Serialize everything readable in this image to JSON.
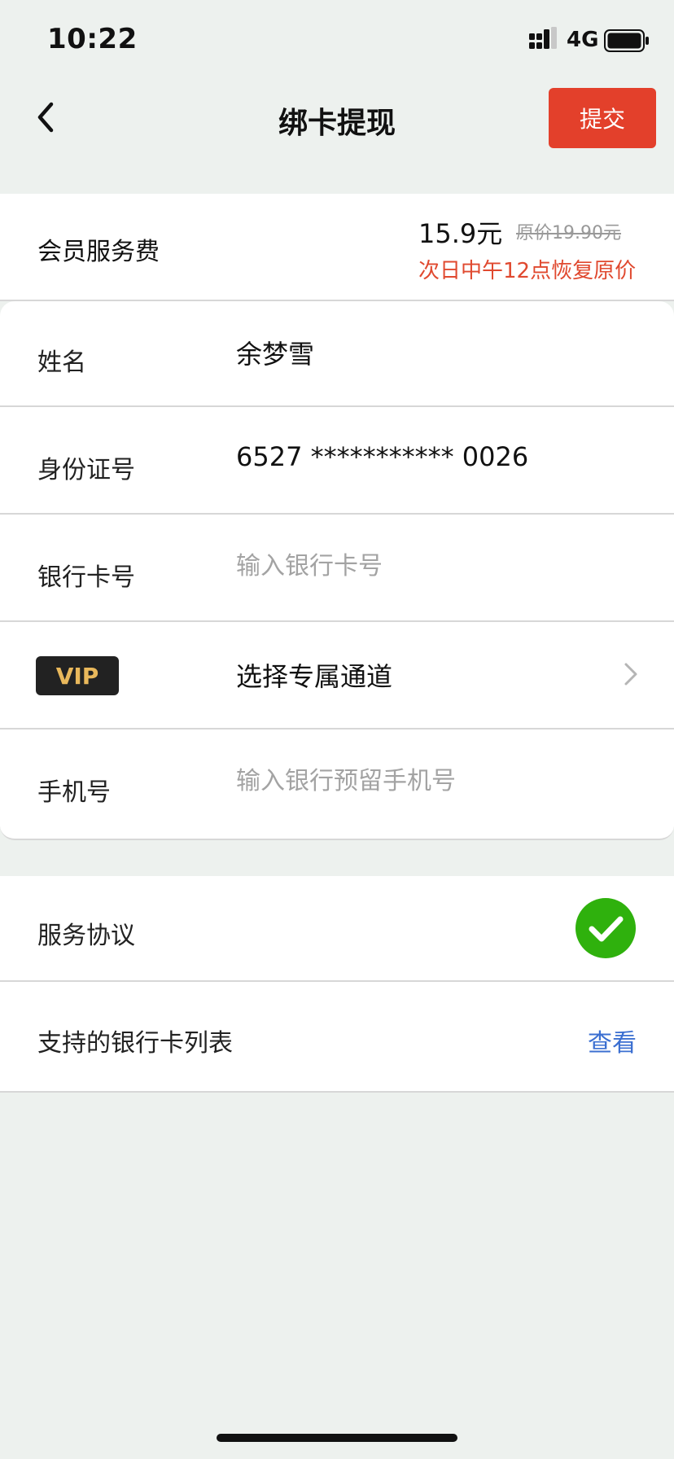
{
  "status_bar": {
    "time": "10:22",
    "network": "4G"
  },
  "nav": {
    "title": "绑卡提现",
    "submit_label": "提交"
  },
  "fee": {
    "label": "会员服务费",
    "price": "15.9元",
    "original_price": "原价19.90元",
    "note": "次日中午12点恢复原价"
  },
  "form": {
    "name": {
      "label": "姓名",
      "value": "余梦雪"
    },
    "id_number": {
      "label": "身份证号",
      "value": "6527 *********** 0026"
    },
    "bank_card": {
      "label": "银行卡号",
      "placeholder": "输入银行卡号"
    },
    "vip": {
      "badge": "VIP",
      "label": "选择专属通道"
    },
    "phone": {
      "label": "手机号",
      "placeholder": "输入银行预留手机号"
    }
  },
  "agreement": {
    "service_label": "服务协议",
    "bank_list_label": "支持的银行卡列表",
    "view_label": "查看"
  },
  "colors": {
    "accent_red": "#e3402b",
    "note_red": "#e0492f",
    "check_green": "#2fb10d",
    "link_blue": "#3b6fd1",
    "vip_gold": "#e9b85b"
  },
  "icons": {
    "back": "chevron-left-icon",
    "vip_arrow": "chevron-right-icon",
    "agreement_check": "check-circle-icon",
    "signal": "signal-icon",
    "battery": "battery-icon"
  }
}
